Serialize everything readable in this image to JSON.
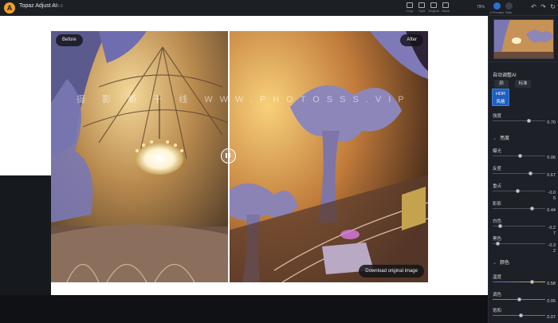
{
  "app": {
    "title": "Topaz Adjust AI",
    "version": "v1.0.0"
  },
  "toolbar": {
    "tools": [
      {
        "label": "Crop",
        "icon": "crop-icon"
      },
      {
        "label": "Split",
        "icon": "split-view-icon"
      },
      {
        "label": "Original",
        "icon": "original-icon"
      },
      {
        "label": "Mask",
        "icon": "mask-icon"
      }
    ],
    "zoom": "79%",
    "views": [
      {
        "label": "1 Preview",
        "icon": "single-preview-icon"
      },
      {
        "label": "Side",
        "icon": "side-by-side-icon"
      }
    ],
    "window": {
      "undo": "↶",
      "redo": "↷",
      "refresh": "↻"
    }
  },
  "canvas": {
    "before_label": "Before",
    "after_label": "After",
    "watermark": "摄 影 新 干 线 WWW.PHOTOSSS.VIP",
    "download_label": "Download original image",
    "split_position": 0.47
  },
  "panel": {
    "auto_title": "自动调整AI",
    "modes": [
      "颜",
      "标准",
      "HDR风格"
    ],
    "active_mode": "HDR风格",
    "strength": {
      "label": "强度",
      "value": "0.70",
      "fraction": 0.7
    },
    "sections": [
      {
        "title": "亮度",
        "sliders": [
          {
            "label": "曝光",
            "value": "0.06",
            "fraction": 0.53
          },
          {
            "label": "反差",
            "value": "0.67",
            "fraction": 0.72
          },
          {
            "label": "重点",
            "value": "-0.0 5",
            "fraction": 0.48
          },
          {
            "label": "影影",
            "value": "0.44",
            "fraction": 0.76
          },
          {
            "label": "白色",
            "value": "-0.2 7",
            "fraction": 0.15
          },
          {
            "label": "黑色",
            "value": "-0.3 2",
            "fraction": 0.1
          }
        ]
      },
      {
        "title": "颜色",
        "sliders": [
          {
            "label": "温度",
            "value": "0.58",
            "fraction": 0.75,
            "style": "temp"
          },
          {
            "label": "调色",
            "value": "0.05",
            "fraction": 0.52,
            "style": "tint"
          },
          {
            "label": "饱和",
            "value": "0.07",
            "fraction": 0.54,
            "style": "sat"
          }
        ]
      }
    ]
  },
  "colors": {
    "accent": "#1f5fbf",
    "panel_bg": "#1d2026",
    "titlebar_bg": "#1c1f24"
  }
}
